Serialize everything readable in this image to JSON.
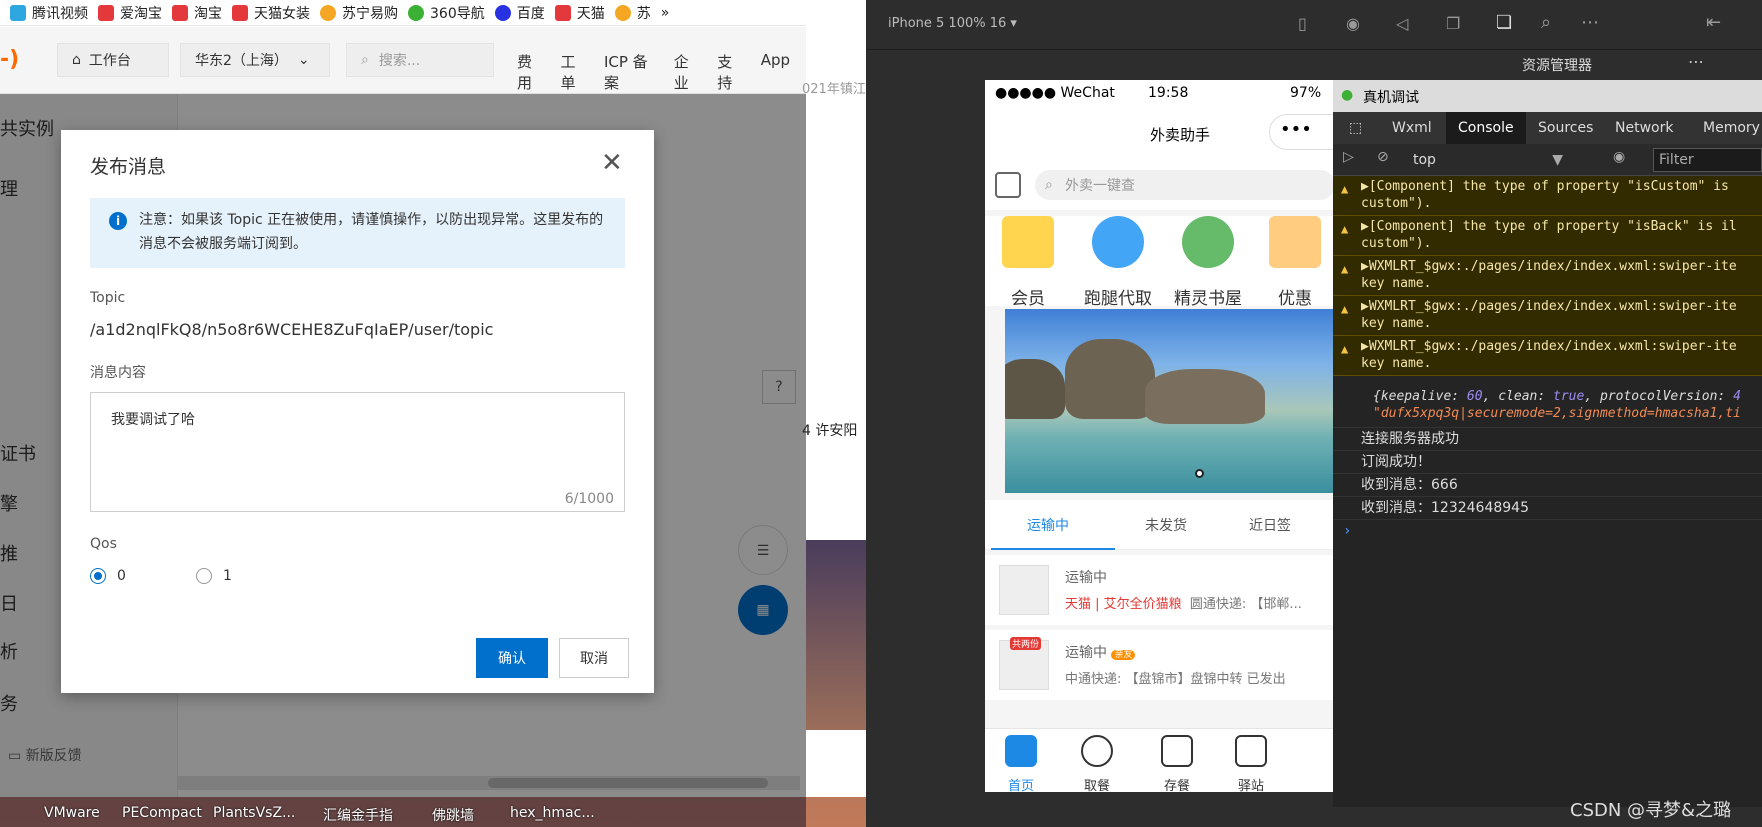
{
  "bookmarks": [
    {
      "label": "腾讯视频",
      "color": "#2ea7e0"
    },
    {
      "label": "爱淘宝",
      "color": "#e4393c"
    },
    {
      "label": "淘宝",
      "color": "#e4393c"
    },
    {
      "label": "天猫女装",
      "color": "#e4393c"
    },
    {
      "label": "苏宁易购",
      "color": "#f5a623"
    },
    {
      "label": "360导航",
      "color": "#3cb034"
    },
    {
      "label": "百度",
      "color": "#2932e1"
    },
    {
      "label": "天猫",
      "color": "#e4393c"
    },
    {
      "label": "苏",
      "color": "#f5a623"
    }
  ],
  "console_nav": {
    "workbench": "工作台",
    "region": "华东2（上海）",
    "search_placeholder": "搜索...",
    "menu": [
      "费用",
      "工单",
      "ICP 备案",
      "企业",
      "支持",
      "App"
    ]
  },
  "sidebar": {
    "items": [
      "共实例",
      "理",
      "",
      "",
      "证书",
      "擎",
      "推",
      "日",
      "析",
      "务"
    ],
    "feedback": "新版反馈"
  },
  "dialog": {
    "title": "发布消息",
    "notice": "注意：如果该 Topic 正在被使用，请谨慎操作，以防出现异常。这里发布的消息不会被服务端订阅到。",
    "topic_label": "Topic",
    "topic_value": "/a1d2nqlFkQ8/n5o8r6WCEHE8ZuFqIaEP/user/topic",
    "content_label": "消息内容",
    "content_value": "我要调试了哈",
    "content_count": "6/1000",
    "qos_label": "Qos",
    "qos_options": [
      "0",
      "1"
    ],
    "qos_selected": "0",
    "ok": "确认",
    "cancel": "取消"
  },
  "background_texts": {
    "behind1": "021年镇江",
    "behind2": "4 许安阳"
  },
  "devtools": {
    "sim_label": "iPhone 5 100% 16 ▾",
    "resource_manager": "资源管理器"
  },
  "phone": {
    "carrier": "●●●●● WeChat",
    "time": "19:58",
    "battery": "97%",
    "nav_title": "外卖助手",
    "search_placeholder": "外卖一键查",
    "categories": [
      "会员",
      "跑腿代取",
      "精灵书屋",
      "优惠"
    ],
    "order_tabs": [
      "运输中",
      "未发货",
      "近日签"
    ],
    "orders": [
      {
        "status": "运输中",
        "shop": "天猫 | 艾尔全价猫粮",
        "desc": "圆通快递: 【邯郸..."
      },
      {
        "status": "运输中",
        "badge": "亲友",
        "tag": "共两份",
        "desc": "中通快递: 【盘锦市】盘锦中转 已发出"
      }
    ],
    "tabbar": [
      "首页",
      "取餐",
      "存餐",
      "驿站"
    ]
  },
  "debug": {
    "title": "真机调试",
    "tabs": [
      "Wxml",
      "Console",
      "Sources",
      "Network",
      "Memory"
    ],
    "active_tab": "Console",
    "context": "top",
    "filter": "Filter",
    "warnings": [
      {
        "line1": "▶[Component] the type of property \"isCustom\" is",
        "line2": "custom\")."
      },
      {
        "line1": "▶[Component] the type of property \"isBack\" is il",
        "line2": "custom\")."
      },
      {
        "line1": "▶WXMLRT_$gwx:./pages/index/index.wxml:swiper-ite",
        "line2": "key name."
      },
      {
        "line1": "▶WXMLRT_$gwx:./pages/index/index.wxml:swiper-ite",
        "line2": "key name."
      },
      {
        "line1": "▶WXMLRT_$gwx:./pages/index/index.wxml:swiper-ite",
        "line2": "key name."
      }
    ],
    "object_log": {
      "keepalive_key": "{keepalive: ",
      "keepalive_val": "60",
      "clean_key": ", clean: ",
      "clean_val": "true",
      "proto_key": ", protocolVersion: ",
      "proto_val": "4",
      "line2": "\"dufx5xpq3q|securemode=2,signmethod=hmacsha1,ti"
    },
    "logs": [
      "连接服务器成功",
      "订阅成功！",
      "收到消息：666",
      "收到消息：12324648945"
    ],
    "prompt": "›"
  },
  "taskbar": [
    "VMware",
    "PECompact",
    "PlantsVsZ...",
    "汇编金手指",
    "佛跳墙",
    "hex_hmac..."
  ],
  "watermark": "CSDN @寻梦&之璐",
  "colors": {
    "primary": "#0070cc",
    "wechat_blue": "#1e88e5",
    "warn_bg": "#332b00"
  }
}
